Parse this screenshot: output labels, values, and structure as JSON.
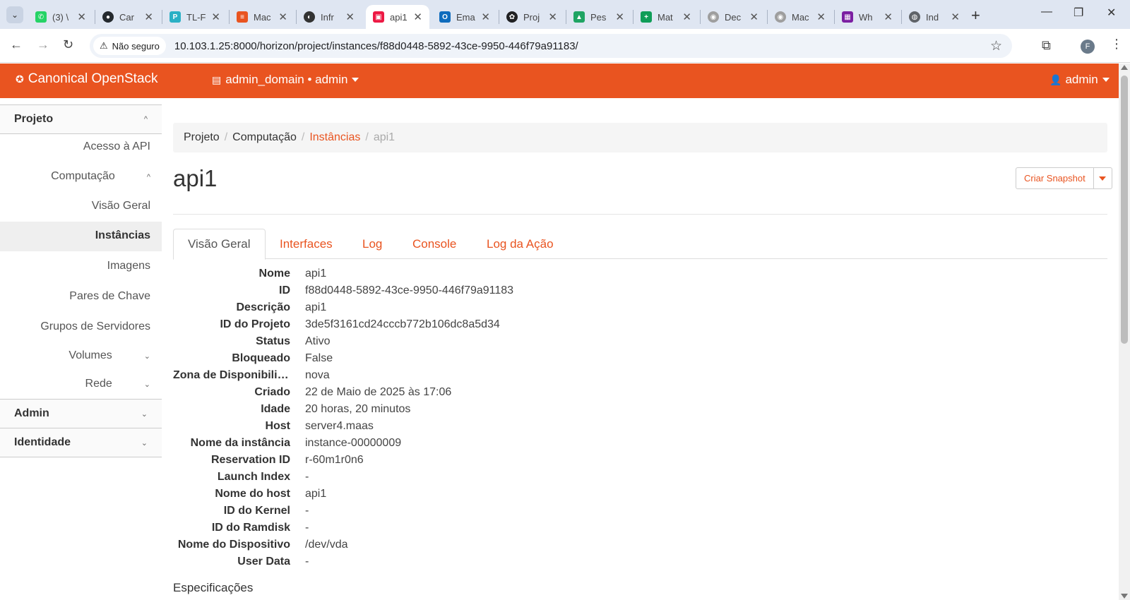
{
  "browser": {
    "tabs": [
      {
        "title": "(3) \\",
        "icon": "whatsapp-icon",
        "color": "#25d366"
      },
      {
        "title": "Car",
        "icon": "github-icon",
        "color": "#24292e"
      },
      {
        "title": "TL-F",
        "icon": "tplink-icon",
        "color": "#2ab0c5"
      },
      {
        "title": "Mac",
        "icon": "maas-icon",
        "color": "#e95420"
      },
      {
        "title": "Infr",
        "icon": "infra-icon",
        "color": "#333333"
      },
      {
        "title": "api1",
        "icon": "openstack-icon",
        "color": "#ed1944"
      },
      {
        "title": "Ema",
        "icon": "outlook-icon",
        "color": "#0f6cbd"
      },
      {
        "title": "Proj",
        "icon": "openai-icon",
        "color": "#202123"
      },
      {
        "title": "Pes",
        "icon": "drive-icon",
        "color": "#1fa463"
      },
      {
        "title": "Mat",
        "icon": "sheets-icon",
        "color": "#0f9d58"
      },
      {
        "title": "Dec",
        "icon": "doc-icon",
        "color": "#9e9e9e"
      },
      {
        "title": "Mac",
        "icon": "doc-icon",
        "color": "#9e9e9e"
      },
      {
        "title": "Wh",
        "icon": "calendar-icon",
        "color": "#7b1fa2"
      },
      {
        "title": "Ind",
        "icon": "globe-icon",
        "color": "#5f6368"
      }
    ],
    "active_tab": 5,
    "security_label": "Não seguro",
    "url": "10.103.1.25:8000/horizon/project/instances/f88d0448-5892-43ce-9950-446f79a91183/",
    "profile_initial": "F"
  },
  "header": {
    "brand": "Canonical OpenStack",
    "project": "admin_domain • admin",
    "user": "admin",
    "accent_color": "#e95420"
  },
  "sidebar": {
    "sections": [
      {
        "label": "Projeto"
      },
      {
        "label": "Admin"
      },
      {
        "label": "Identidade"
      }
    ],
    "items": [
      {
        "label": "Acesso à API"
      },
      {
        "label": "Computação"
      },
      {
        "label": "Visão Geral"
      },
      {
        "label": "Instâncias"
      },
      {
        "label": "Imagens"
      },
      {
        "label": "Pares de Chave"
      },
      {
        "label": "Grupos de Servidores"
      },
      {
        "label": "Volumes"
      },
      {
        "label": "Rede"
      }
    ],
    "active_item": "Instâncias"
  },
  "breadcrumb": [
    "Projeto",
    "Computação",
    "Instâncias",
    "api1"
  ],
  "page": {
    "title": "api1",
    "snapshot_button": "Criar Snapshot",
    "tabs": [
      "Visão Geral",
      "Interfaces",
      "Log",
      "Console",
      "Log da Ação"
    ],
    "active_tab": "Visão Geral",
    "details": [
      {
        "label": "Nome",
        "value": "api1"
      },
      {
        "label": "ID",
        "value": "f88d0448-5892-43ce-9950-446f79a91183"
      },
      {
        "label": "Descrição",
        "value": "api1"
      },
      {
        "label": "ID do Projeto",
        "value": "3de5f3161cd24cccb772b106dc8a5d34"
      },
      {
        "label": "Status",
        "value": "Ativo"
      },
      {
        "label": "Bloqueado",
        "value": "False"
      },
      {
        "label": "Zona de Disponibilidade",
        "value": "nova"
      },
      {
        "label": "Criado",
        "value": "22 de Maio de 2025 às 17:06"
      },
      {
        "label": "Idade",
        "value": "20 horas, 20 minutos"
      },
      {
        "label": "Host",
        "value": "server4.maas"
      },
      {
        "label": "Nome da instância",
        "value": "instance-00000009"
      },
      {
        "label": "Reservation ID",
        "value": "r-60m1r0n6"
      },
      {
        "label": "Launch Index",
        "value": "-"
      },
      {
        "label": "Nome do host",
        "value": "api1"
      },
      {
        "label": "ID do Kernel",
        "value": "-"
      },
      {
        "label": "ID do Ramdisk",
        "value": "-"
      },
      {
        "label": "Nome do Dispositivo",
        "value": "/dev/vda"
      },
      {
        "label": "User Data",
        "value": "-"
      }
    ],
    "specs_heading": "Especificações"
  }
}
